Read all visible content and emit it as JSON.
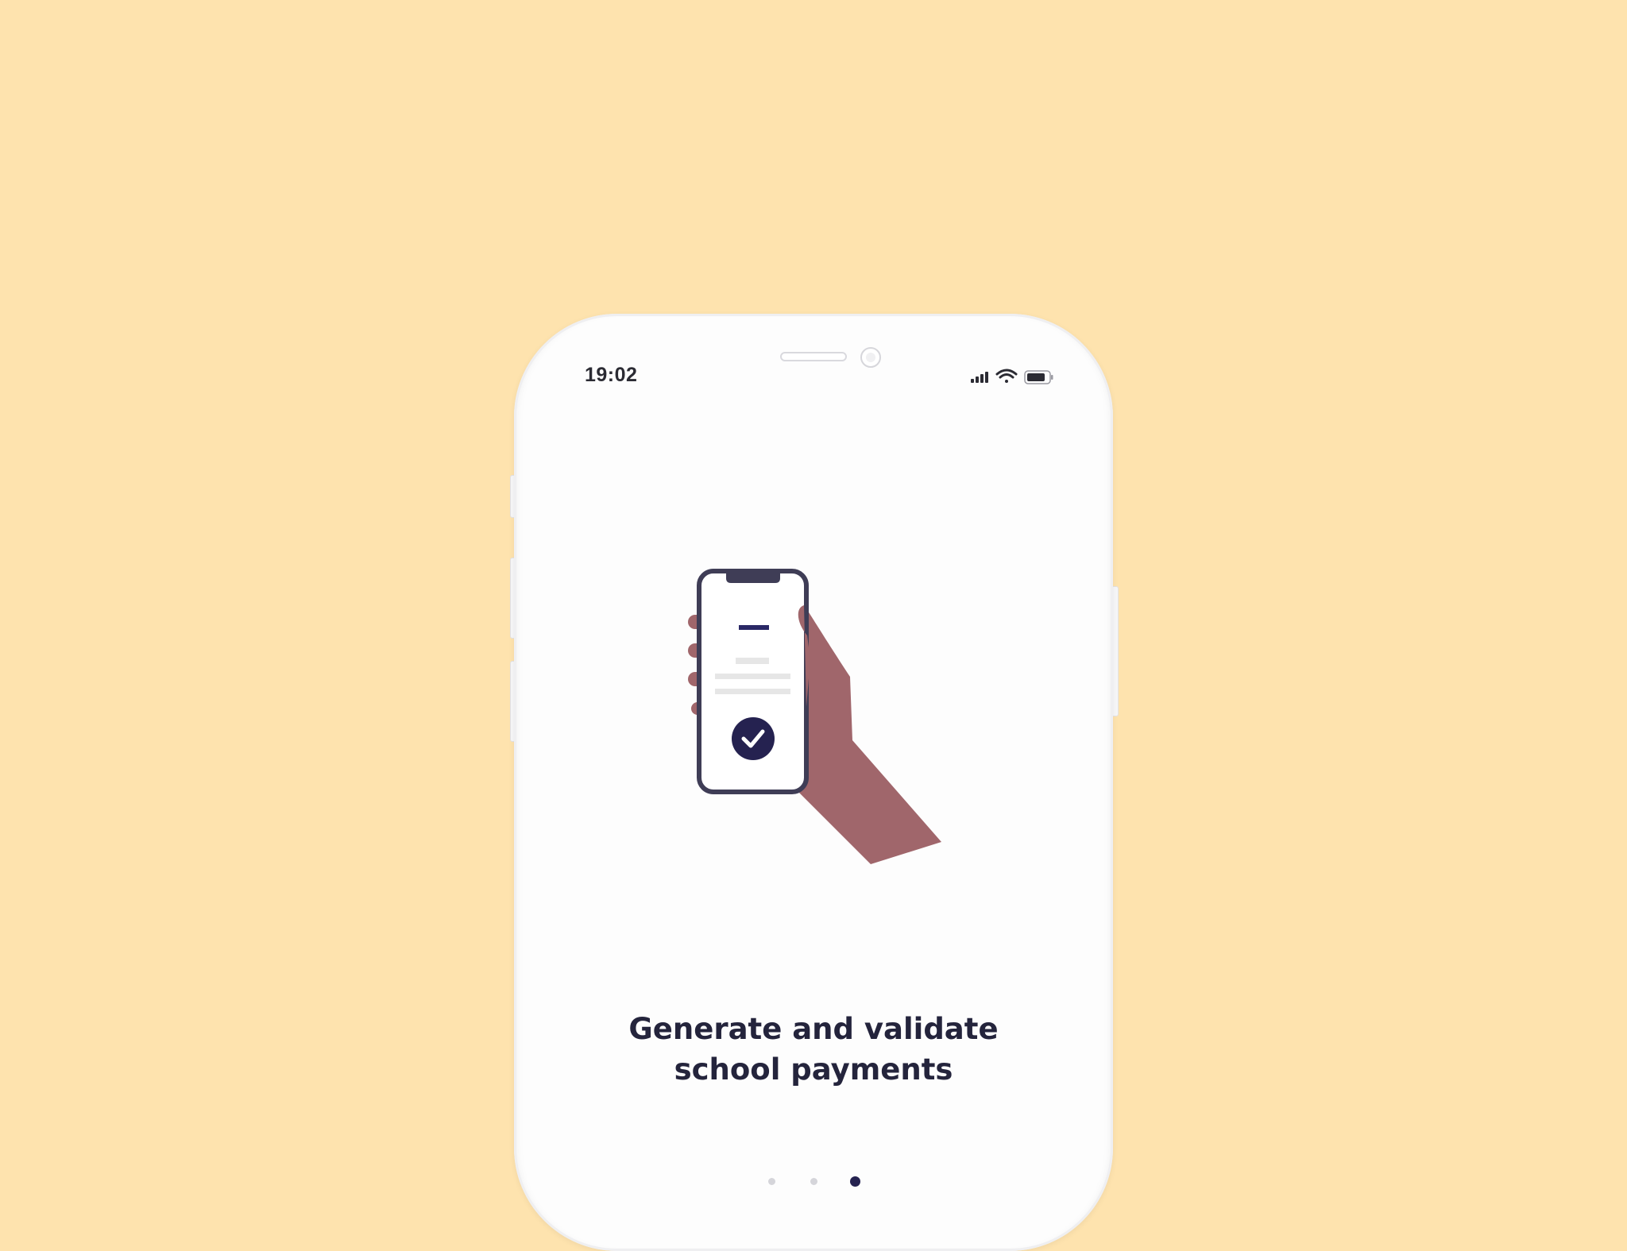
{
  "status_bar": {
    "time": "19:02",
    "icons": [
      "signal-icon",
      "wifi-icon",
      "battery-icon"
    ]
  },
  "onboarding": {
    "illustration": "hand-holding-phone-with-checkmark",
    "headline_line1": "Generate and validate",
    "headline_line2": "school payments",
    "pager": {
      "total": 3,
      "active_index": 2
    }
  },
  "colors": {
    "background": "#FEE3AE",
    "screen": "#FDFDFD",
    "accent": "#252250",
    "skin": "#A0666B",
    "text": "#24243C"
  }
}
